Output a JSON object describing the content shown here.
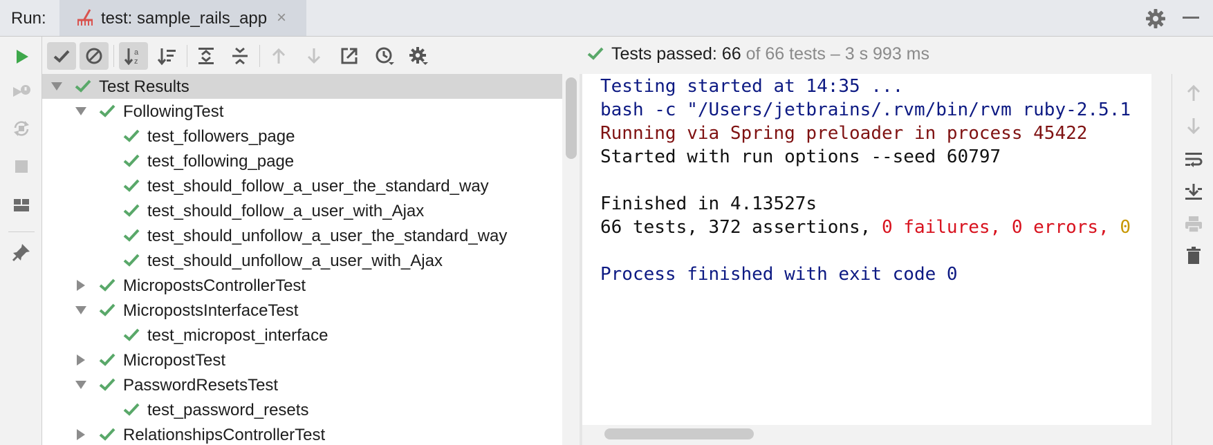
{
  "topbar": {
    "run_label": "Run:",
    "tab_label": "test: sample_rails_app",
    "tab_close": "×"
  },
  "status": {
    "passed_label": "Tests passed: 66",
    "of_label": "of 66 tests – 3 s 993 ms"
  },
  "tree": {
    "root": "Test Results",
    "rows": [
      "FollowingTest",
      "test_followers_page",
      "test_following_page",
      "test_should_follow_a_user_the_standard_way",
      "test_should_follow_a_user_with_Ajax",
      "test_should_unfollow_a_user_the_standard_way",
      "test_should_unfollow_a_user_with_Ajax",
      "MicropostsControllerTest",
      "MicropostsInterfaceTest",
      "test_micropost_interface",
      "MicropostTest",
      "PasswordResetsTest",
      "test_password_resets",
      "RelationshipsControllerTest"
    ]
  },
  "console": {
    "line1": "Testing started at 14:35 ...",
    "line2": "bash -c \"/Users/jetbrains/.rvm/bin/rvm ruby-2.5.1",
    "line3": "Running via Spring preloader in process 45422",
    "line4": "Started with run options --seed 60797",
    "line5": "Finished in 4.13527s",
    "line6_a": "66 tests, 372 assertions, ",
    "line6_b": "0 failures, 0 errors, ",
    "line6_c": "0",
    "line7": "Process finished with exit code 0"
  },
  "colors": {
    "pass_green": "#59a869",
    "run_green": "#3ea84b",
    "console_blue": "#0d1a83",
    "console_red": "#7f1212",
    "failure_red": "#d8121e",
    "skip_amber": "#c79700"
  }
}
